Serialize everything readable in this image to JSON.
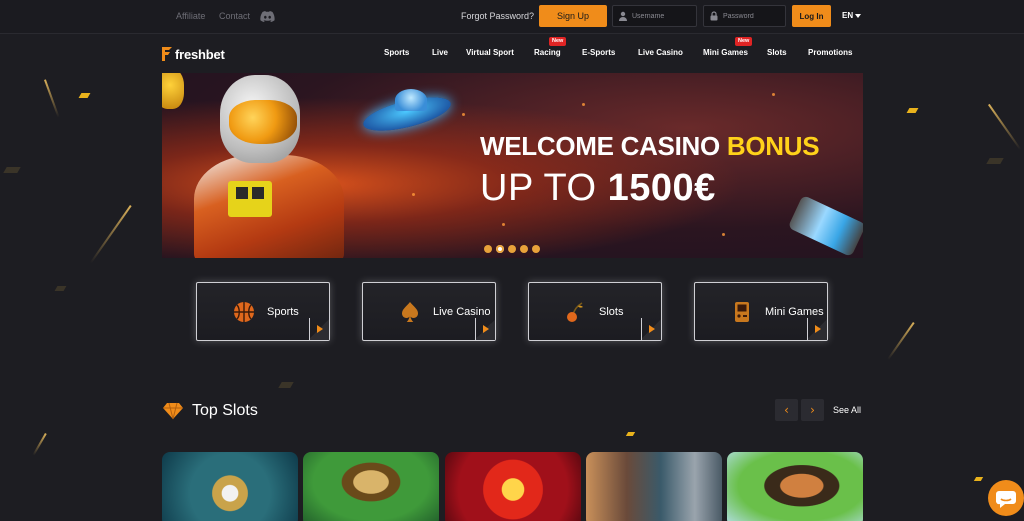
{
  "topbar": {
    "affiliate": "Affiliate",
    "contact": "Contact",
    "forgot_password": "Forgot Password?",
    "signup": "Sign Up",
    "username_placeholder": "Username",
    "password_placeholder": "Password",
    "login": "Log In",
    "language": "EN"
  },
  "nav": {
    "logo": "freshbet",
    "items": [
      {
        "label": "Sports"
      },
      {
        "label": "Live"
      },
      {
        "label": "Virtual Sport"
      },
      {
        "label": "Racing",
        "badge": "New"
      },
      {
        "label": "E-Sports"
      },
      {
        "label": "Live Casino"
      },
      {
        "label": "Mini Games",
        "badge": "New"
      },
      {
        "label": "Slots"
      },
      {
        "label": "Promotions"
      }
    ]
  },
  "hero": {
    "line1_prefix": "WELCOME CASINO",
    "line1_highlight": "BONUS",
    "line2_prefix": "UP TO",
    "line2_amount": "1500€",
    "slide_count": 5,
    "active_slide": 2
  },
  "categories": [
    {
      "label": "Sports",
      "icon": "basketball-icon"
    },
    {
      "label": "Live Casino",
      "icon": "spade-icon"
    },
    {
      "label": "Slots",
      "icon": "cherry-icon"
    },
    {
      "label": "Mini Games",
      "icon": "arcade-icon"
    }
  ],
  "top_slots": {
    "title": "Top Slots",
    "prev": "‹",
    "next": "›",
    "see_all": "See All",
    "games": [
      {
        "icon": "pearl-shell-slot-thumbnail"
      },
      {
        "icon": "tiki-slot-thumbnail"
      },
      {
        "icon": "lucky-sevens-slot-thumbnail"
      },
      {
        "icon": "vikings-slot-thumbnail"
      },
      {
        "icon": "pirate-slot-thumbnail"
      }
    ]
  },
  "colors": {
    "accent": "#f08c1a",
    "background": "#1d1d22",
    "bonus_yellow": "#ffd21a",
    "badge_red": "#e02424"
  }
}
